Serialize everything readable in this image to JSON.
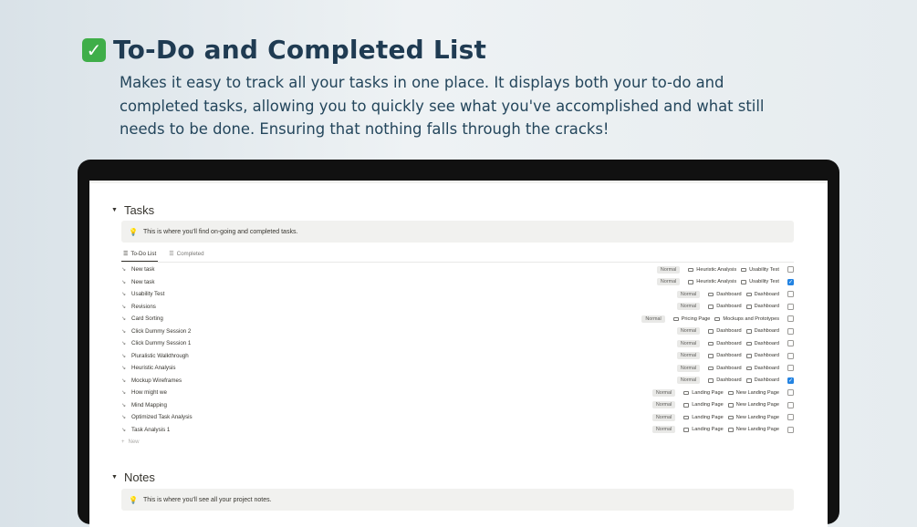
{
  "header": {
    "check_glyph": "✓",
    "title": "To-Do and Completed List",
    "description": "Makes it easy to track all your tasks in one place. It displays both your to-do and completed tasks, allowing you to quickly see what you've accomplished and what still needs to be done. Ensuring that nothing falls through the cracks!"
  },
  "tasks": {
    "heading": "Tasks",
    "callout": "This is where you'll find on-going and completed tasks.",
    "tabs": [
      {
        "label": "To-Do List",
        "icon": "list-icon",
        "active": true
      },
      {
        "label": "Completed",
        "icon": "list-icon",
        "active": false
      }
    ],
    "rows": [
      {
        "name": "New task",
        "priority": "Normal",
        "link1": "Heuristic Analysis",
        "link2": "Usability Test",
        "done": false
      },
      {
        "name": "New task",
        "priority": "Normal",
        "link1": "Heuristic Analysis",
        "link2": "Usability Test",
        "done": true
      },
      {
        "name": "Usability Test",
        "priority": "Normal",
        "link1": "Dashboard",
        "link2": "Dashboard",
        "done": false
      },
      {
        "name": "Revisions",
        "priority": "Normal",
        "link1": "Dashboard",
        "link2": "Dashboard",
        "done": false
      },
      {
        "name": "Card Sorting",
        "priority": "Normal",
        "link1": "Pricing Page",
        "link2": "Mockups and Prototypes",
        "done": false
      },
      {
        "name": "Click Dummy Session 2",
        "priority": "Normal",
        "link1": "Dashboard",
        "link2": "Dashboard",
        "done": false
      },
      {
        "name": "Click Dummy Session 1",
        "priority": "Normal",
        "link1": "Dashboard",
        "link2": "Dashboard",
        "done": false
      },
      {
        "name": "Pluralistic Walkthrough",
        "priority": "Normal",
        "link1": "Dashboard",
        "link2": "Dashboard",
        "done": false
      },
      {
        "name": "Heuristic Analysis",
        "priority": "Normal",
        "link1": "Dashboard",
        "link2": "Dashboard",
        "done": false
      },
      {
        "name": "Mockup Wireframes",
        "priority": "Normal",
        "link1": "Dashboard",
        "link2": "Dashboard",
        "done": true
      },
      {
        "name": "How might we",
        "priority": "Normal",
        "link1": "Landing Page",
        "link2": "New Landing Page",
        "done": false
      },
      {
        "name": "Mind Mapping",
        "priority": "Normal",
        "link1": "Landing Page",
        "link2": "New Landing Page",
        "done": false
      },
      {
        "name": "Optimized Task Analysis",
        "priority": "Normal",
        "link1": "Landing Page",
        "link2": "New Landing Page",
        "done": false
      },
      {
        "name": "Task Analysis 1",
        "priority": "Normal",
        "link1": "Landing Page",
        "link2": "New Landing Page",
        "done": false
      }
    ],
    "new_label": "New"
  },
  "notes": {
    "heading": "Notes",
    "callout": "This is where you'll see all your project notes."
  },
  "colors": {
    "title": "#1f3b52",
    "checkbox_checked": "#2383e2",
    "callout_bg": "#f1f1ef"
  }
}
